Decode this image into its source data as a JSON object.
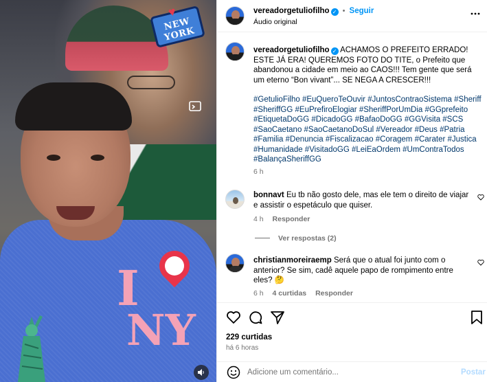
{
  "post": {
    "username": "vereadorgetuliofilho",
    "follow_label": "Seguir",
    "audio_label": "Áudio original",
    "more_icon": "more-horizontal-icon"
  },
  "media": {
    "sticker_text": "NEW YORK",
    "sticker_i": "I",
    "sticker_ny": "NY",
    "audio_icon": "speaker-icon"
  },
  "caption": {
    "text": "ACHAMOS O PREFEITO ERRADO! ESTE JÁ ERA! QUEREMOS FOTO DO TITE, o Prefeito que abandonou a cidade em meio ao CAOS!!! Tem gente que será um eterno “Bon vivant”... SE NEGA A CRESCER!!!",
    "hashtags": "#GetulioFilho #EuQueroTeOuvir #JuntosContraoSistema #Sheriff #SheriffGG #EuPrefiroElogiar #SheriffPorUmDia #GGprefeito #EtiquetaDoGG #DicadoGG #BafaoDoGG #GGVisita #SCS #SaoCaetano #SaoCaetanoDoSul #Vereador #Deus #Patria #Familia #Denuncia #Fiscalizacao #Coragem #Carater #Justica #Humanidade #VisitadoGG #LeiEaOrdem #UmContraTodos #BalançaSheriffGG",
    "time": "6 h"
  },
  "comments": [
    {
      "username": "bonnavt",
      "text": "Eu tb não gosto dele, mas ele tem o direito de viajar e assistir o espetáculo que quiser.",
      "time": "4 h",
      "reply_label": "Responder",
      "view_replies": "Ver respostas (2)"
    },
    {
      "username": "christianmoreiraemp",
      "text": "Será que o atual foi junto com o anterior? Se sim, cadê aquele papo de rompimento entre eles?",
      "emoji": "🤔",
      "time": "6 h",
      "likes": "4 curtidas",
      "reply_label": "Responder"
    }
  ],
  "actions": {
    "likes": "229 curtidas",
    "time": "há 6 horas",
    "icons": [
      "heart-icon",
      "comment-icon",
      "share-icon",
      "bookmark-icon"
    ]
  },
  "add_comment": {
    "placeholder": "Adicione um comentário...",
    "post_label": "Postar",
    "emoji_icon": "emoji-icon"
  }
}
